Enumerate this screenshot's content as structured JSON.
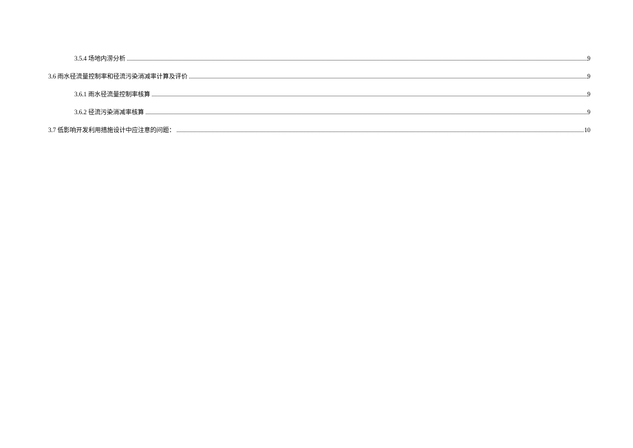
{
  "toc": [
    {
      "indent": 1,
      "label": "3.5.4 场地内涝分析",
      "page": "9"
    },
    {
      "indent": 0,
      "label": "3.6 雨水径流量控制率和径流污染消减率计算及评价",
      "page": "9"
    },
    {
      "indent": 1,
      "label": "3.6.1 雨水径流量控制率核算",
      "page": "9"
    },
    {
      "indent": 1,
      "label": "3.6.2 径流污染消减率核算",
      "page": "9"
    },
    {
      "indent": 0,
      "label": "3.7 低影响开发利用措施设计中应注意的问题：",
      "page": "10"
    }
  ]
}
